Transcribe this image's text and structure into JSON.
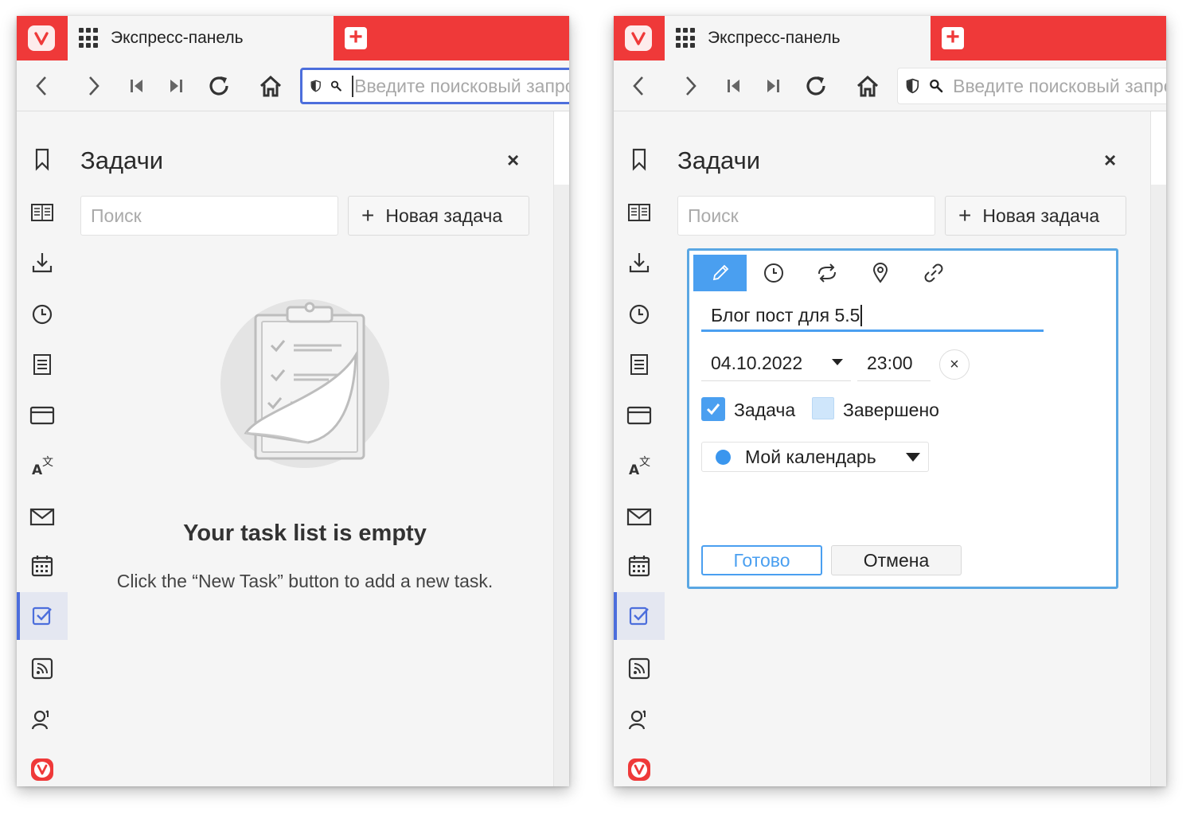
{
  "tab": {
    "title": "Экспресс-панель"
  },
  "toolbar": {
    "address_placeholder": "Введите поисковый запрос"
  },
  "panel": {
    "title": "Задачи",
    "close_glyph": "×",
    "search_placeholder": "Поиск",
    "new_task_plus": "+",
    "new_task_label": "Новая задача"
  },
  "empty_state": {
    "title": "Your task list is empty",
    "description": "Click the “New Task” button to add a new task."
  },
  "task_editor": {
    "title_value": "Блог пост для 5.5",
    "date_value": "04.10.2022",
    "time_value": "23:00",
    "clear_glyph": "×",
    "task_checkbox_label": "Задача",
    "task_checked": true,
    "completed_checkbox_label": "Завершено",
    "completed_checked": false,
    "calendar_label": "Мой календарь",
    "calendar_color": "#3a96ee",
    "done_button": "Готово",
    "cancel_button": "Отмена"
  },
  "colors": {
    "brand_red": "#ef3939",
    "accent_blue": "#4a9ff0",
    "focus_blue": "#4c6edc"
  },
  "sidebar_icons": [
    "bookmark-icon",
    "reading-list-icon",
    "downloads-icon",
    "history-icon",
    "notes-icon",
    "window-icon",
    "translate-icon",
    "mail-icon",
    "calendar-icon",
    "tasks-icon",
    "feeds-icon",
    "contacts-icon",
    "vivaldi-icon"
  ]
}
